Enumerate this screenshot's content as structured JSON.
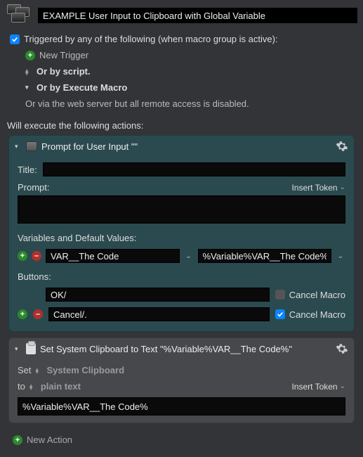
{
  "header": {
    "title": "EXAMPLE User Input to Clipboard with Global Variable"
  },
  "trigger": {
    "heading": "Triggered by any of the following (when macro group is active):",
    "new_trigger": "New Trigger",
    "by_script": "Or by script.",
    "by_execute_macro": "Or by Execute Macro",
    "web_server": "Or via the web server but all remote access is disabled."
  },
  "actions_label": "Will execute the following actions:",
  "action1": {
    "title": "Prompt for User Input \"\"",
    "title_label": "Title:",
    "title_value": "",
    "prompt_label": "Prompt:",
    "insert_token": "Insert Token",
    "prompt_value": "",
    "vars_label": "Variables and Default Values:",
    "var_name": "VAR__The Code",
    "var_default": "%Variable%VAR__The Code%",
    "buttons_label": "Buttons:",
    "btn_ok": "OK/",
    "btn_cancel": "Cancel/.",
    "cancel_macro_label": "Cancel Macro"
  },
  "action2": {
    "title": "Set System Clipboard to Text \"%Variable%VAR__The Code%\"",
    "set_label": "Set",
    "set_target": "System Clipboard",
    "to_label": "to",
    "to_format": "plain text",
    "insert_token": "Insert Token",
    "text_value": "%Variable%VAR__The Code%"
  },
  "footer": {
    "new_action": "New Action"
  }
}
